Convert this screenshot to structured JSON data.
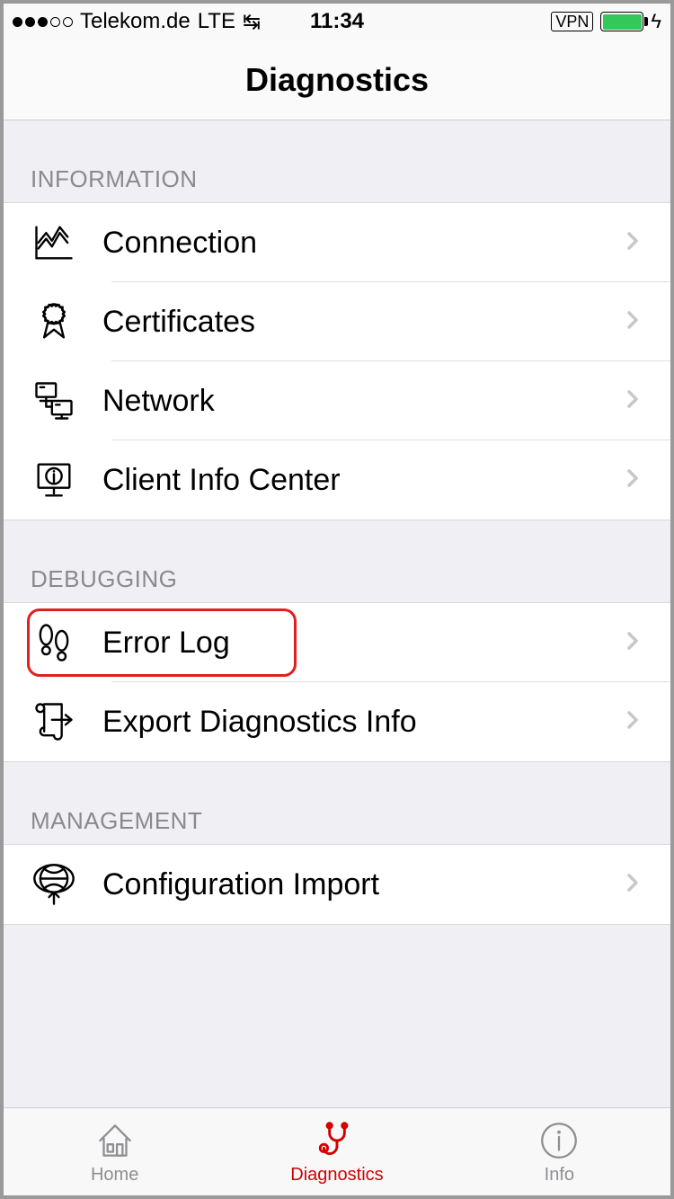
{
  "status": {
    "carrier": "Telekom.de",
    "network": "LTE",
    "time": "11:34",
    "vpn": "VPN"
  },
  "nav": {
    "title": "Diagnostics"
  },
  "sections": {
    "information": {
      "header": "INFORMATION",
      "connection": "Connection",
      "certificates": "Certificates",
      "network": "Network",
      "client_info_center": "Client Info Center"
    },
    "debugging": {
      "header": "DEBUGGING",
      "error_log": "Error Log",
      "export_diag": "Export Diagnostics Info"
    },
    "management": {
      "header": "MANAGEMENT",
      "config_import": "Configuration Import"
    }
  },
  "tabs": {
    "home": "Home",
    "diagnostics": "Diagnostics",
    "info": "Info"
  }
}
